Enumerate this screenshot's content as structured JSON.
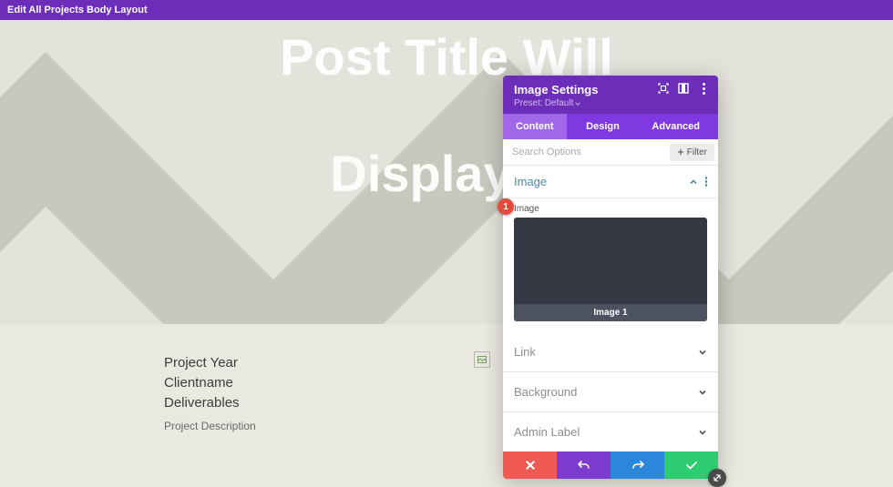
{
  "colors": {
    "purple": "#6c2eb9",
    "purple_light": "#8038e0",
    "accent": "#4e8aa8",
    "red": "#ef5a55",
    "blue": "#2b87da",
    "green": "#2ecc71",
    "badge": "#e54b3c"
  },
  "topbar": {
    "title": "Edit All Projects Body Layout"
  },
  "hero": {
    "line1": "Post Title Will",
    "line2": "Display H"
  },
  "meta": {
    "lines": [
      "Project Year",
      "Clientname",
      "Deliverables"
    ],
    "description": "Project Description"
  },
  "panel": {
    "title": "Image Settings",
    "preset_label": "Preset:",
    "preset_value": "Default",
    "tabs": {
      "content": "Content",
      "design": "Design",
      "advanced": "Advanced",
      "active": "content"
    },
    "search": {
      "placeholder": "Search Options",
      "filter_label": "Filter"
    },
    "sections": {
      "image": {
        "title": "Image",
        "field_label": "Image",
        "preview_caption": "Image 1",
        "expanded": true
      },
      "link": {
        "title": "Link",
        "expanded": false
      },
      "background": {
        "title": "Background",
        "expanded": false
      },
      "admin": {
        "title": "Admin Label",
        "expanded": false
      }
    }
  },
  "badge": {
    "number": "1"
  }
}
